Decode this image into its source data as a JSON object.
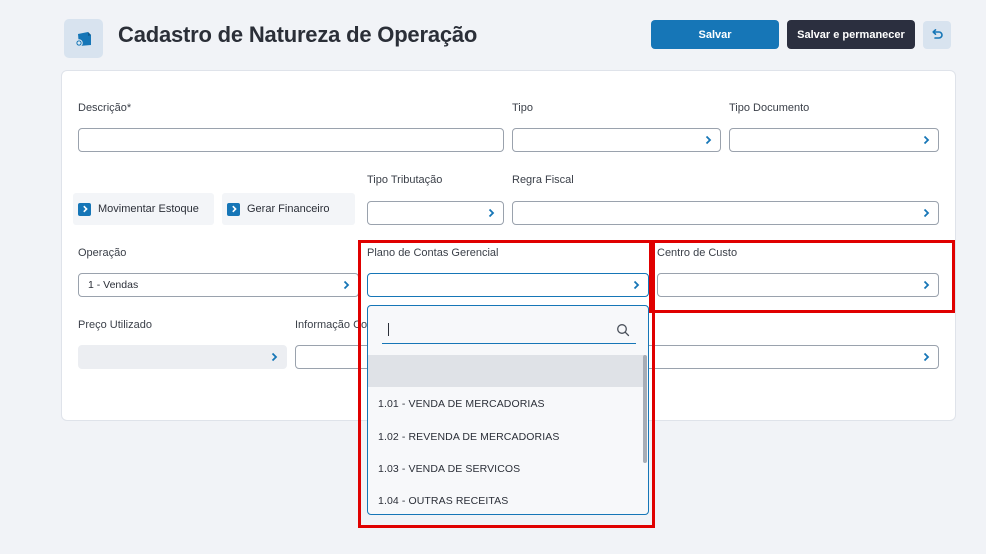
{
  "header": {
    "title": "Cadastro de Natureza de Operação",
    "save_label": "Salvar",
    "save_stay_label": "Salvar e permanecer"
  },
  "form": {
    "descricao_label": "Descrição*",
    "descricao_value": "",
    "tipo_label": "Tipo",
    "tipo_value": "",
    "tipo_documento_label": "Tipo Documento",
    "tipo_documento_value": "",
    "movimentar_estoque_label": "Movimentar Estoque",
    "gerar_financeiro_label": "Gerar Financeiro",
    "tipo_tributacao_label": "Tipo Tributação",
    "tipo_tributacao_value": "",
    "regra_fiscal_label": "Regra Fiscal",
    "regra_fiscal_value": "",
    "operacao_label": "Operação",
    "operacao_value": "1 - Vendas",
    "plano_contas_label": "Plano de Contas Gerencial",
    "plano_contas_value": "",
    "centro_custo_label": "Centro de Custo",
    "centro_custo_value": "",
    "preco_utilizado_label": "Preço Utilizado",
    "preco_utilizado_value": "",
    "informacao_label": "Informação Co",
    "informacao_value": ""
  },
  "dropdown": {
    "search_value": "",
    "items": [
      "1.01 - VENDA DE MERCADORIAS",
      "1.02 - REVENDA DE MERCADORIAS",
      "1.03 - VENDA DE SERVICOS",
      "1.04 - OUTRAS RECEITAS"
    ]
  },
  "colors": {
    "primary": "#1676b7",
    "dark": "#2b2f3f",
    "highlight": "#e00000"
  }
}
